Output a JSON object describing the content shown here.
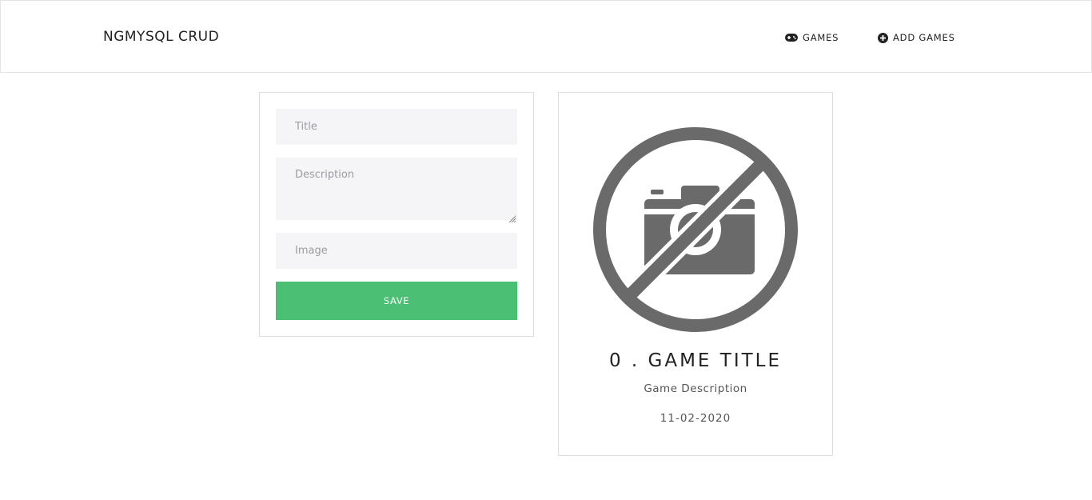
{
  "navbar": {
    "brand": "NGMYSQL CRUD",
    "links": [
      {
        "label": "GAMES",
        "icon": "gamepad-icon"
      },
      {
        "label": "ADD GAMES",
        "icon": "plus-circle-icon"
      }
    ]
  },
  "form": {
    "title_placeholder": "Title",
    "description_placeholder": "Description",
    "image_placeholder": "Image",
    "title_value": "",
    "description_value": "",
    "image_value": "",
    "save_label": "SAVE",
    "save_color": "#4bbf73"
  },
  "game_card": {
    "image_icon": "no-photo-icon",
    "title": "0 . GAME TITLE",
    "description": "Game Description",
    "date": "11-02-2020"
  }
}
